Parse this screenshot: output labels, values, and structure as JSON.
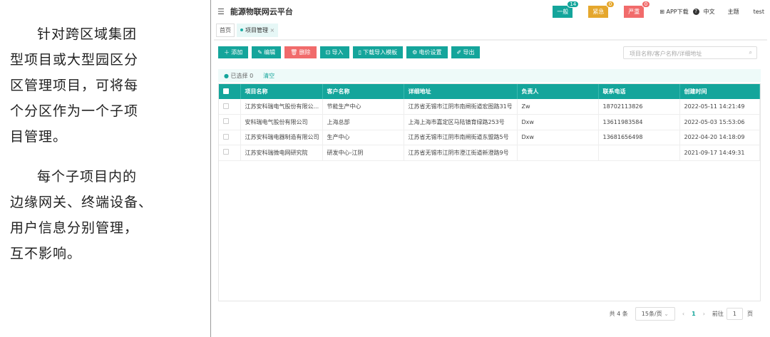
{
  "left_text": {
    "p1": [
      "针对跨区域集团",
      "型项目或大型园区分",
      "区管理项目，可将每",
      "个分区作为一个子项",
      "目管理。"
    ],
    "p2": [
      "每个子项目内的",
      "边缘网关、终端设备、",
      "用户信息分别管理，",
      "互不影响。"
    ]
  },
  "header": {
    "title": "能源物联网云平台",
    "alerts": [
      {
        "label": "一般",
        "count": "14",
        "color": "#14a59b",
        "count_color": "#14a59b"
      },
      {
        "label": "紧急",
        "count": "0",
        "color": "#e5a72d",
        "count_color": "#e5a72d"
      },
      {
        "label": "严重",
        "count": "0",
        "color": "#f16b6b",
        "count_color": "#f16b6b"
      }
    ],
    "app_download": "APP下载",
    "language": "中文",
    "theme": "主题",
    "user": "test"
  },
  "tabs": [
    {
      "label": "首页"
    },
    {
      "label": "项目管理",
      "close": "×"
    }
  ],
  "toolbar": {
    "add": "添加",
    "edit": "编辑",
    "delete": "删除",
    "import": "导入",
    "download_template": "下载导入模板",
    "price_settings": "电价设置",
    "export": "导出"
  },
  "search": {
    "placeholder": "项目名称/客户名称/详细地址"
  },
  "selection": {
    "text": "已选择 0",
    "clear": "清空"
  },
  "table": {
    "headers": [
      "项目名称",
      "客户名称",
      "详细地址",
      "负责人",
      "联系电话",
      "创建时间"
    ],
    "rows": [
      [
        "江苏安科瑞电气股份有限公...",
        "节能生产中心",
        "江苏省无锡市江阴市南闸街道宏图路31号",
        "Zw",
        "18702113826",
        "2022-05-11 14:21:49"
      ],
      [
        "安科瑞电气股份有限公司",
        "上海总部",
        "上海上海市嘉定区马陆镇育绿路253号",
        "Dxw",
        "13611983584",
        "2022-05-03 15:53:06"
      ],
      [
        "江苏安科瑞电器制造有限公司",
        "生产中心",
        "江苏省无锡市江阴市南闸街道东盟路5号",
        "Dxw",
        "13681656498",
        "2022-04-20 14:18:09"
      ],
      [
        "江苏安科瑞微电网研究院",
        "研发中心-江阴",
        "江苏省无锡市江阴市澄江街道新澄路9号",
        "",
        "",
        "2021-09-17 14:49:31"
      ]
    ]
  },
  "pager": {
    "total": "共 4 条",
    "page_size": "15条/页",
    "current": "1",
    "goto": "前往",
    "goto_value": "1",
    "page_unit": "页"
  }
}
